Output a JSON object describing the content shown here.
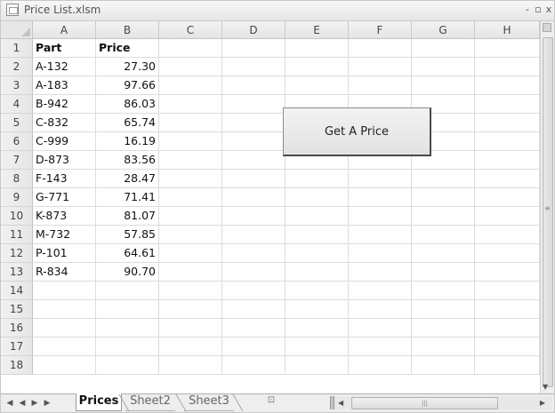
{
  "window": {
    "title": "Price List.xlsm",
    "minimize_glyph": "-",
    "restore_glyph": "▫",
    "close_glyph": "x"
  },
  "columns": [
    "A",
    "B",
    "C",
    "D",
    "E",
    "F",
    "G",
    "H"
  ],
  "rows": [
    "1",
    "2",
    "3",
    "4",
    "5",
    "6",
    "7",
    "8",
    "9",
    "10",
    "11",
    "12",
    "13",
    "14",
    "15",
    "16",
    "17",
    "18"
  ],
  "header_row": {
    "a": "Part",
    "b": "Price"
  },
  "data_rows": [
    {
      "part": "A-132",
      "price": "27.30"
    },
    {
      "part": "A-183",
      "price": "97.66"
    },
    {
      "part": "B-942",
      "price": "86.03"
    },
    {
      "part": "C-832",
      "price": "65.74"
    },
    {
      "part": "C-999",
      "price": "16.19"
    },
    {
      "part": "D-873",
      "price": "83.56"
    },
    {
      "part": "F-143",
      "price": "28.47"
    },
    {
      "part": "G-771",
      "price": "71.41"
    },
    {
      "part": "K-873",
      "price": "81.07"
    },
    {
      "part": "M-732",
      "price": "57.85"
    },
    {
      "part": "P-101",
      "price": "64.61"
    },
    {
      "part": "R-834",
      "price": "90.70"
    }
  ],
  "button": {
    "label": "Get A Price"
  },
  "tabs": [
    {
      "label": "Prices",
      "active": true
    },
    {
      "label": "Sheet2",
      "active": false
    },
    {
      "label": "Sheet3",
      "active": false
    }
  ],
  "nav_glyphs": {
    "first": "◀",
    "prev": "◀",
    "next": "▶",
    "last": "▶"
  },
  "icons": {
    "app": "excel-doc-icon",
    "new_sheet": "insert-sheet-icon",
    "scroll_grip": "scroll-grip-icon"
  },
  "colors": {
    "header_bg": "#e6e6e6",
    "grid_line": "#dcdcdc",
    "active_tab": "#ffffff"
  }
}
